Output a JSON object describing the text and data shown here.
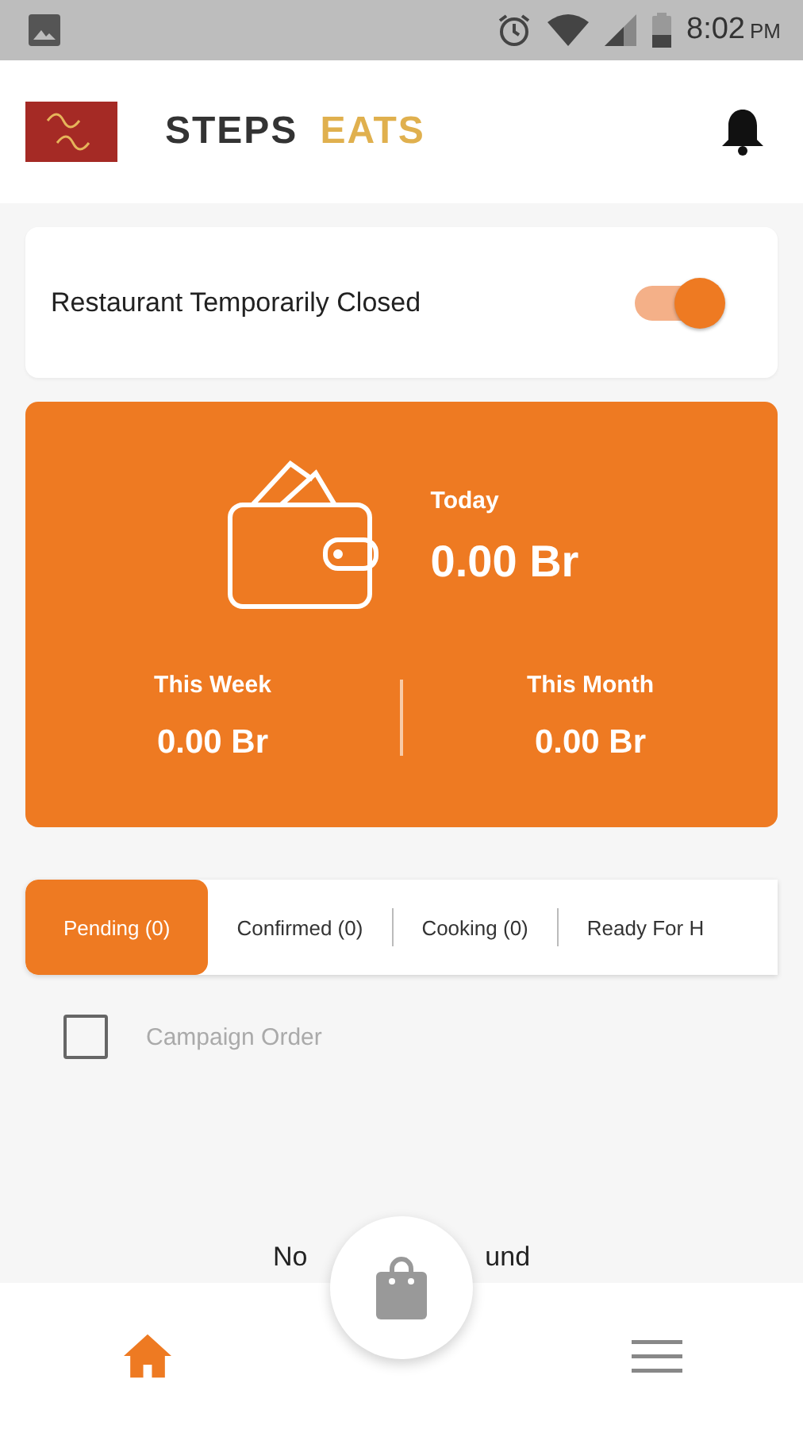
{
  "status_bar": {
    "time": "8:02",
    "meridiem": "PM"
  },
  "header": {
    "brand_first": "STEPS",
    "brand_second": "EATS"
  },
  "closed_toggle": {
    "label": "Restaurant Temporarily Closed",
    "on": true
  },
  "earnings": {
    "today": {
      "label": "Today",
      "value": "0.00 Br"
    },
    "week": {
      "label": "This Week",
      "value": "0.00 Br"
    },
    "month": {
      "label": "This Month",
      "value": "0.00 Br"
    }
  },
  "tabs": [
    {
      "label": "Pending (0)",
      "selected": true
    },
    {
      "label": "Confirmed (0)",
      "selected": false
    },
    {
      "label": "Cooking (0)",
      "selected": false
    },
    {
      "label": "Ready For H",
      "selected": false
    }
  ],
  "campaign_filter": {
    "label": "Campaign Order",
    "checked": false
  },
  "empty_message": {
    "visible_start": "No",
    "visible_end": "und"
  },
  "bottom_nav": [
    {
      "kind": "home",
      "selected": true
    },
    {
      "kind": "menu",
      "selected": false
    }
  ]
}
